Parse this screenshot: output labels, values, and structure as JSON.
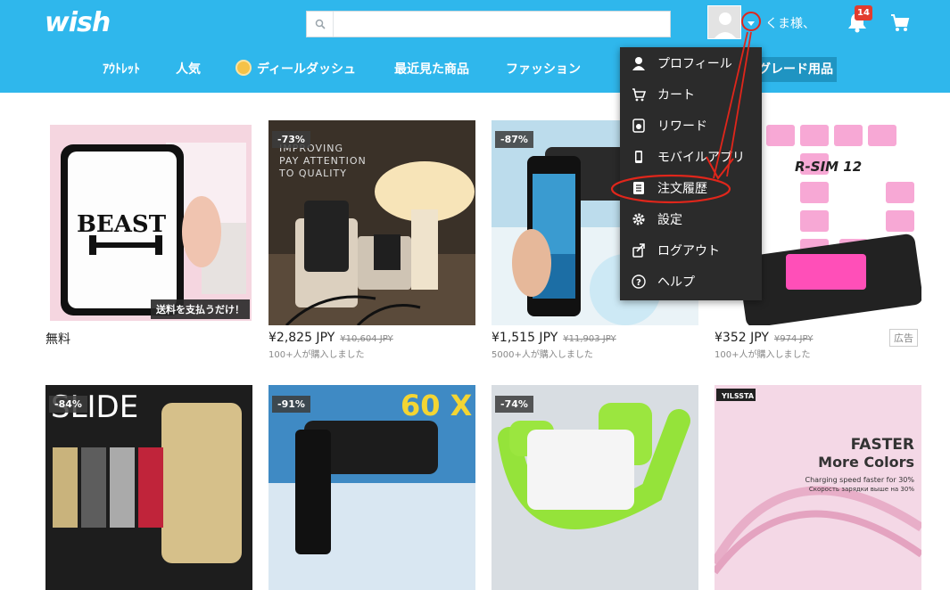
{
  "header": {
    "logo": "wish",
    "search": {
      "placeholder": "",
      "value": ""
    },
    "username": "くま様、",
    "notification_count": "14",
    "colors": {
      "primary": "#2fb7ec",
      "highlight": "#1f94c2",
      "annotation": "#e0261b"
    }
  },
  "nav": {
    "items": [
      {
        "label": "ｱｳﾄﾚｯﾄ"
      },
      {
        "label": "人気"
      },
      {
        "label": "ディールダッシュ",
        "icon": "deal-dash-icon"
      },
      {
        "label": "最近見た商品"
      },
      {
        "label": "ファッション"
      },
      {
        "label": "グレード用品"
      }
    ]
  },
  "menu": {
    "items": [
      {
        "label": "プロフィール",
        "icon": "person-icon"
      },
      {
        "label": "カート",
        "icon": "cart-icon"
      },
      {
        "label": "リワード",
        "icon": "rewards-icon"
      },
      {
        "label": "モバイルアプリ",
        "icon": "phone-icon"
      },
      {
        "label": "注文履歴",
        "icon": "order-history-icon",
        "annotated": true
      },
      {
        "label": "設定",
        "icon": "gear-icon"
      },
      {
        "label": "ログアウト",
        "icon": "logout-icon"
      },
      {
        "label": "ヘルプ",
        "icon": "help-icon"
      }
    ]
  },
  "products": [
    {
      "price": "無料",
      "old_price": "",
      "sold": "",
      "discount": "",
      "badge": "送料を支払うだけ！",
      "ad": "",
      "theme": "beast-phone-case",
      "overlay_text": "BEAST"
    },
    {
      "price": "¥2,825 JPY",
      "old_price": "¥10,604 JPY",
      "sold": "100+人が購入しました",
      "discount": "-73%",
      "badge": "",
      "ad": "",
      "theme": "mushroom-lamp",
      "overlay_text": "IMPROVING\nPAY ATTENTION\nTO QUALITY"
    },
    {
      "price": "¥1,515 JPY",
      "old_price": "¥11,903 JPY",
      "sold": "5000+人が購入しました",
      "discount": "-87%",
      "badge": "",
      "ad": "",
      "theme": "phone-telescope",
      "overlay_text": ""
    },
    {
      "price": "¥352 JPY",
      "old_price": "¥974 JPY",
      "sold": "100+人が購入しました",
      "discount": "",
      "badge": "",
      "ad": "広告",
      "theme": "r-sim",
      "overlay_text": "R-SIM 12"
    },
    {
      "price": "",
      "old_price": "",
      "sold": "",
      "discount": "-84%",
      "badge": "",
      "ad": "",
      "theme": "slide-case",
      "overlay_text": "SLIDE"
    },
    {
      "price": "",
      "old_price": "",
      "sold": "",
      "discount": "-91%",
      "badge": "",
      "ad": "",
      "theme": "monocular-60x",
      "overlay_text": "60 X"
    },
    {
      "price": "",
      "old_price": "",
      "sold": "",
      "discount": "-74%",
      "badge": "",
      "ad": "",
      "theme": "thumb-holder",
      "overlay_text": ""
    },
    {
      "price": "",
      "old_price": "",
      "sold": "",
      "discount": "",
      "badge": "",
      "ad": "",
      "theme": "cable",
      "overlay_text": "FASTER\nMore Colors",
      "brand": "YILSSTA",
      "caption": "Charging speed faster for 30%",
      "caption2": "Скорость зарядки выше на 30%"
    }
  ]
}
